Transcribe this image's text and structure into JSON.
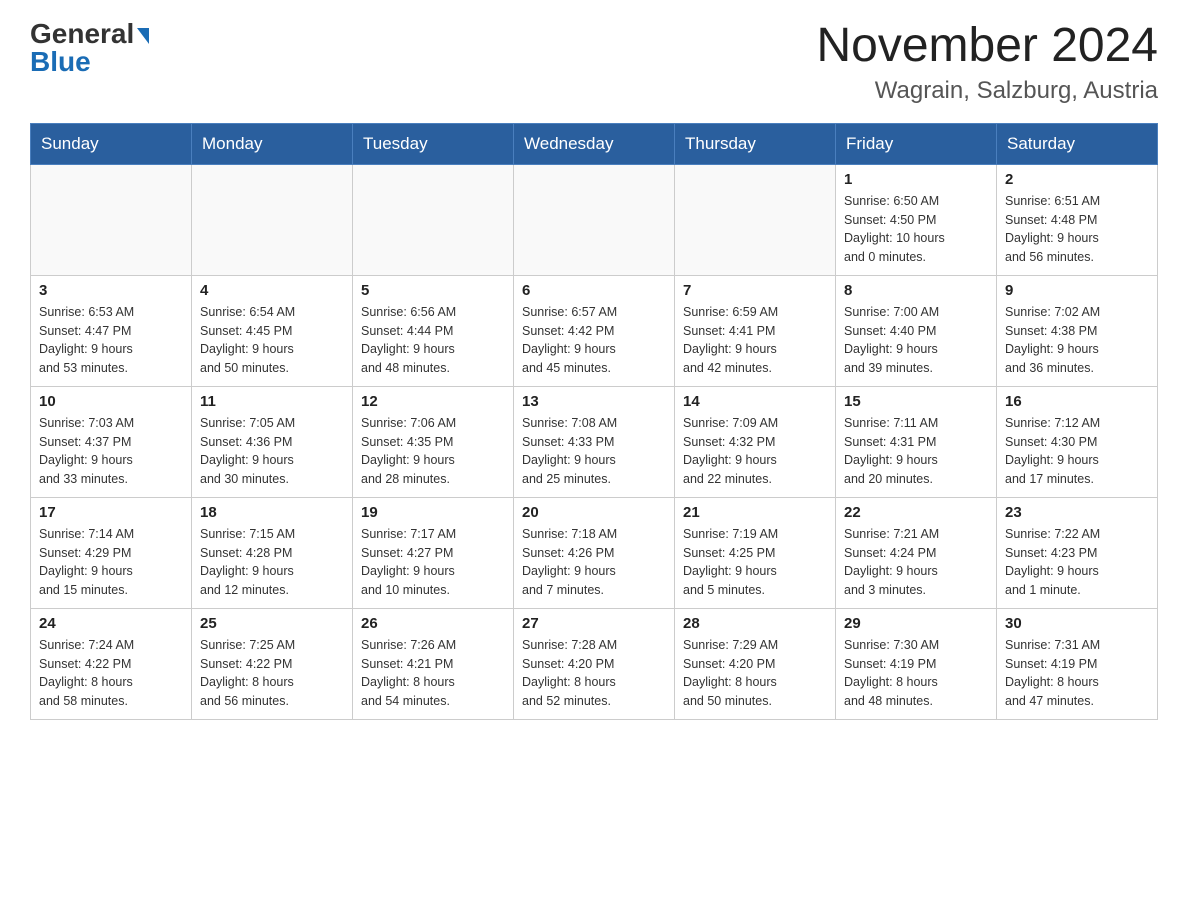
{
  "header": {
    "logo_general": "General",
    "logo_blue": "Blue",
    "title": "November 2024",
    "subtitle": "Wagrain, Salzburg, Austria"
  },
  "weekdays": [
    "Sunday",
    "Monday",
    "Tuesday",
    "Wednesday",
    "Thursday",
    "Friday",
    "Saturday"
  ],
  "weeks": [
    [
      {
        "day": "",
        "info": ""
      },
      {
        "day": "",
        "info": ""
      },
      {
        "day": "",
        "info": ""
      },
      {
        "day": "",
        "info": ""
      },
      {
        "day": "",
        "info": ""
      },
      {
        "day": "1",
        "info": "Sunrise: 6:50 AM\nSunset: 4:50 PM\nDaylight: 10 hours\nand 0 minutes."
      },
      {
        "day": "2",
        "info": "Sunrise: 6:51 AM\nSunset: 4:48 PM\nDaylight: 9 hours\nand 56 minutes."
      }
    ],
    [
      {
        "day": "3",
        "info": "Sunrise: 6:53 AM\nSunset: 4:47 PM\nDaylight: 9 hours\nand 53 minutes."
      },
      {
        "day": "4",
        "info": "Sunrise: 6:54 AM\nSunset: 4:45 PM\nDaylight: 9 hours\nand 50 minutes."
      },
      {
        "day": "5",
        "info": "Sunrise: 6:56 AM\nSunset: 4:44 PM\nDaylight: 9 hours\nand 48 minutes."
      },
      {
        "day": "6",
        "info": "Sunrise: 6:57 AM\nSunset: 4:42 PM\nDaylight: 9 hours\nand 45 minutes."
      },
      {
        "day": "7",
        "info": "Sunrise: 6:59 AM\nSunset: 4:41 PM\nDaylight: 9 hours\nand 42 minutes."
      },
      {
        "day": "8",
        "info": "Sunrise: 7:00 AM\nSunset: 4:40 PM\nDaylight: 9 hours\nand 39 minutes."
      },
      {
        "day": "9",
        "info": "Sunrise: 7:02 AM\nSunset: 4:38 PM\nDaylight: 9 hours\nand 36 minutes."
      }
    ],
    [
      {
        "day": "10",
        "info": "Sunrise: 7:03 AM\nSunset: 4:37 PM\nDaylight: 9 hours\nand 33 minutes."
      },
      {
        "day": "11",
        "info": "Sunrise: 7:05 AM\nSunset: 4:36 PM\nDaylight: 9 hours\nand 30 minutes."
      },
      {
        "day": "12",
        "info": "Sunrise: 7:06 AM\nSunset: 4:35 PM\nDaylight: 9 hours\nand 28 minutes."
      },
      {
        "day": "13",
        "info": "Sunrise: 7:08 AM\nSunset: 4:33 PM\nDaylight: 9 hours\nand 25 minutes."
      },
      {
        "day": "14",
        "info": "Sunrise: 7:09 AM\nSunset: 4:32 PM\nDaylight: 9 hours\nand 22 minutes."
      },
      {
        "day": "15",
        "info": "Sunrise: 7:11 AM\nSunset: 4:31 PM\nDaylight: 9 hours\nand 20 minutes."
      },
      {
        "day": "16",
        "info": "Sunrise: 7:12 AM\nSunset: 4:30 PM\nDaylight: 9 hours\nand 17 minutes."
      }
    ],
    [
      {
        "day": "17",
        "info": "Sunrise: 7:14 AM\nSunset: 4:29 PM\nDaylight: 9 hours\nand 15 minutes."
      },
      {
        "day": "18",
        "info": "Sunrise: 7:15 AM\nSunset: 4:28 PM\nDaylight: 9 hours\nand 12 minutes."
      },
      {
        "day": "19",
        "info": "Sunrise: 7:17 AM\nSunset: 4:27 PM\nDaylight: 9 hours\nand 10 minutes."
      },
      {
        "day": "20",
        "info": "Sunrise: 7:18 AM\nSunset: 4:26 PM\nDaylight: 9 hours\nand 7 minutes."
      },
      {
        "day": "21",
        "info": "Sunrise: 7:19 AM\nSunset: 4:25 PM\nDaylight: 9 hours\nand 5 minutes."
      },
      {
        "day": "22",
        "info": "Sunrise: 7:21 AM\nSunset: 4:24 PM\nDaylight: 9 hours\nand 3 minutes."
      },
      {
        "day": "23",
        "info": "Sunrise: 7:22 AM\nSunset: 4:23 PM\nDaylight: 9 hours\nand 1 minute."
      }
    ],
    [
      {
        "day": "24",
        "info": "Sunrise: 7:24 AM\nSunset: 4:22 PM\nDaylight: 8 hours\nand 58 minutes."
      },
      {
        "day": "25",
        "info": "Sunrise: 7:25 AM\nSunset: 4:22 PM\nDaylight: 8 hours\nand 56 minutes."
      },
      {
        "day": "26",
        "info": "Sunrise: 7:26 AM\nSunset: 4:21 PM\nDaylight: 8 hours\nand 54 minutes."
      },
      {
        "day": "27",
        "info": "Sunrise: 7:28 AM\nSunset: 4:20 PM\nDaylight: 8 hours\nand 52 minutes."
      },
      {
        "day": "28",
        "info": "Sunrise: 7:29 AM\nSunset: 4:20 PM\nDaylight: 8 hours\nand 50 minutes."
      },
      {
        "day": "29",
        "info": "Sunrise: 7:30 AM\nSunset: 4:19 PM\nDaylight: 8 hours\nand 48 minutes."
      },
      {
        "day": "30",
        "info": "Sunrise: 7:31 AM\nSunset: 4:19 PM\nDaylight: 8 hours\nand 47 minutes."
      }
    ]
  ]
}
